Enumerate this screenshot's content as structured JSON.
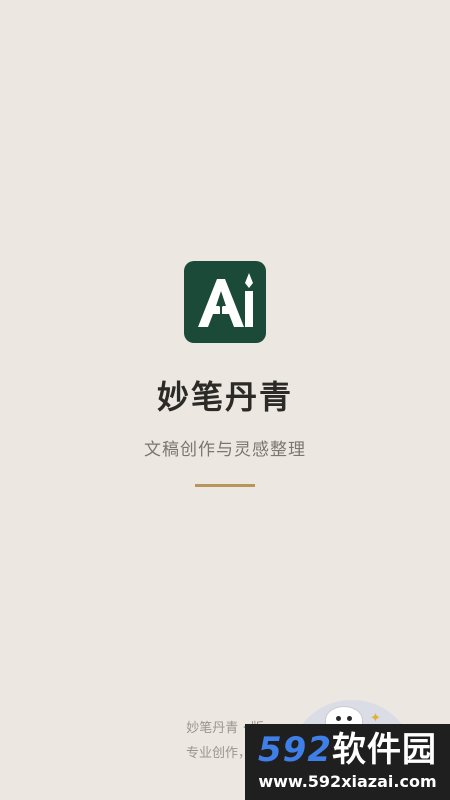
{
  "app": {
    "name": "妙笔丹青",
    "tagline": "文稿创作与灵感整理"
  },
  "logo": {
    "icon": "pen-nib-ai-logo-icon",
    "text": "AI"
  },
  "footer": {
    "line1": "妙笔丹青 · 版",
    "line2": "专业创作，思"
  },
  "watermark": {
    "brand_num": "592",
    "brand_cn": "软件园",
    "url": "www.592xiazai.com"
  },
  "colors": {
    "background": "#ece8e1",
    "logo_bg": "#1c4a38",
    "accent": "#b8965a",
    "title": "#2c2a26",
    "tagline": "#7a7670"
  }
}
